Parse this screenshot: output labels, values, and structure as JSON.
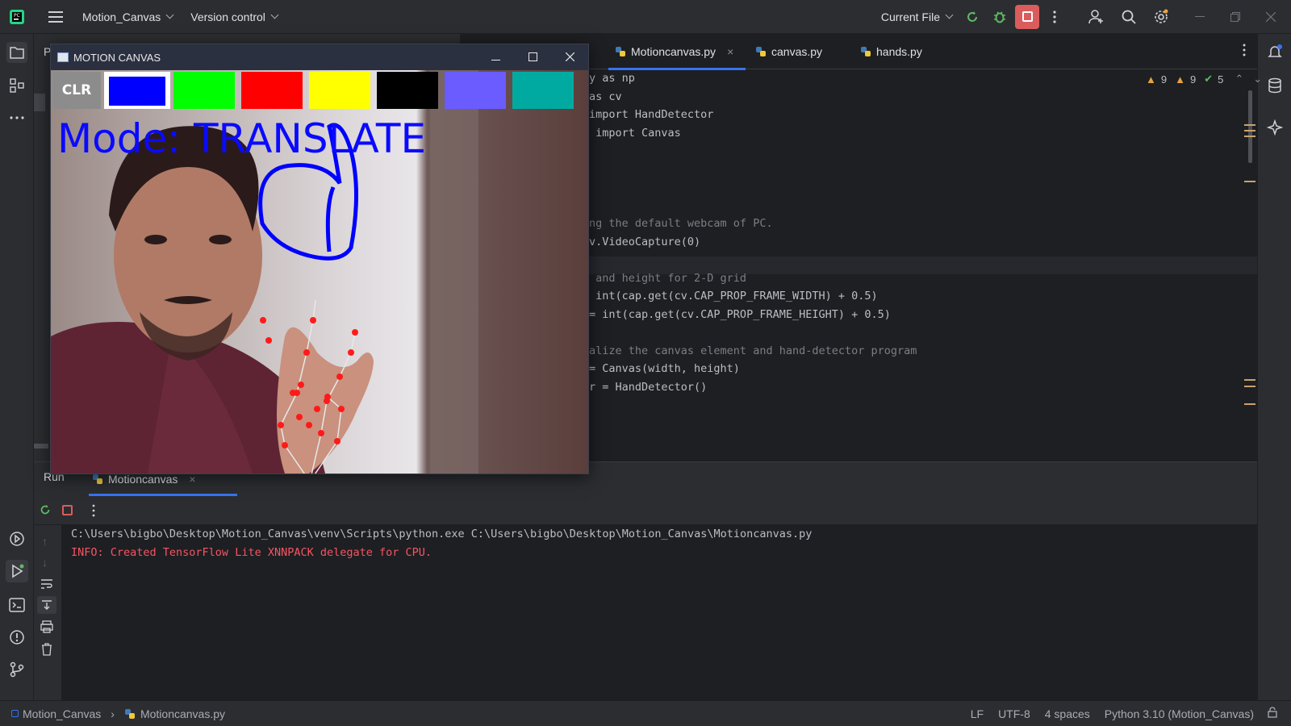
{
  "titlebar": {
    "project": "Motion_Canvas",
    "vcs": "Version control",
    "run_config": "Current File"
  },
  "editor": {
    "tabs": [
      {
        "label": "Motioncanvas.py",
        "active": true,
        "closable": true
      },
      {
        "label": "canvas.py",
        "active": false,
        "closable": false
      },
      {
        "label": "hands.py",
        "active": false,
        "closable": false
      }
    ],
    "inspections": {
      "warnings_a": "9",
      "warnings_b": "9",
      "ok": "5"
    },
    "code": [
      {
        "text": "y as np",
        "kind": "code"
      },
      {
        "text": "as cv",
        "kind": "code"
      },
      {
        "text": "import HandDetector",
        "kind": "code"
      },
      {
        "text": " import Canvas",
        "kind": "code"
      },
      {
        "text": "",
        "kind": "code"
      },
      {
        "text": "",
        "kind": "code"
      },
      {
        "text": "",
        "kind": "code"
      },
      {
        "text": "",
        "kind": "code"
      },
      {
        "text": "ng the default webcam of PC.",
        "kind": "comment"
      },
      {
        "text": "v.VideoCapture(0)",
        "kind": "code"
      },
      {
        "text": "",
        "kind": "code"
      },
      {
        "text": " and height for 2-D grid",
        "kind": "comment"
      },
      {
        "text": " int(cap.get(cv.CAP_PROP_FRAME_WIDTH) + 0.5)",
        "kind": "code"
      },
      {
        "text": "= int(cap.get(cv.CAP_PROP_FRAME_HEIGHT) + 0.5)",
        "kind": "code"
      },
      {
        "text": "",
        "kind": "code"
      },
      {
        "text": "alize the canvas element and hand-detector program",
        "kind": "comment"
      },
      {
        "text": "= Canvas(width, height)",
        "kind": "code"
      },
      {
        "text": "r = HandDetector()",
        "kind": "code"
      }
    ]
  },
  "run": {
    "tab_run": "Run",
    "tab_config": "Motioncanvas",
    "console": [
      {
        "text": "C:\\Users\\bigbo\\Desktop\\Motion_Canvas\\venv\\Scripts\\python.exe C:\\Users\\bigbo\\Desktop\\Motion_Canvas\\Motioncanvas.py",
        "kind": "normal"
      },
      {
        "text": "INFO: Created TensorFlow Lite XNNPACK delegate for CPU.",
        "kind": "error"
      }
    ]
  },
  "statusbar": {
    "project": "Motion_Canvas",
    "file": "Motioncanvas.py",
    "line_sep": "LF",
    "encoding": "UTF-8",
    "indent": "4 spaces",
    "interpreter": "Python 3.10 (Motion_Canvas)"
  },
  "projpanel": {
    "letter": "P"
  },
  "motion_window": {
    "title": "MOTION CANVAS",
    "clear_label": "CLR",
    "mode_text": "Mode: TRANSLATE",
    "swatches": [
      "#0000ff",
      "#00ff00",
      "#ff0000",
      "#ffff00",
      "#000000",
      "#6a5cff",
      "#00aaa0"
    ],
    "selected_swatch": 0
  },
  "colors": {
    "accent": "#3574f0",
    "stop_red": "#db5c5c",
    "warning": "#e8a33d",
    "ok": "#5fb865",
    "error_text": "#f75464"
  }
}
